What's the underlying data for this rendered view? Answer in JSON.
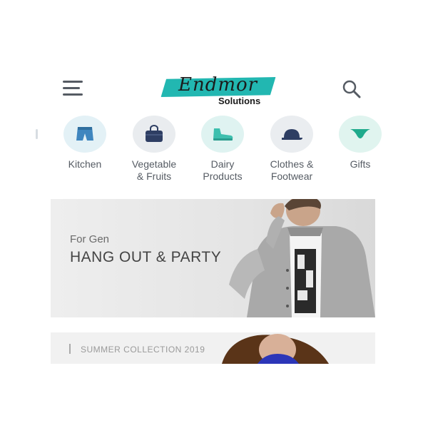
{
  "header": {
    "logo_script": "Endmor",
    "logo_sub": "Solutions",
    "menu_icon": "hamburger-menu-icon",
    "search_icon": "search-icon",
    "brand_color": "#22b7b1"
  },
  "categories": [
    {
      "label": "Kitchen",
      "icon": "shorts-icon",
      "bg": "#e3f1f6"
    },
    {
      "label": "Vegetable\n& Fruits",
      "icon": "handbag-icon",
      "bg": "#e9ecef"
    },
    {
      "label": "Dairy\nProducts",
      "icon": "sneaker-icon",
      "bg": "#dff3f1"
    },
    {
      "label": "Clothes &\nFootwear",
      "icon": "cap-icon",
      "bg": "#eaedf0"
    },
    {
      "label": "Gifts",
      "icon": "swimwear-icon",
      "bg": "#e0f4ef"
    }
  ],
  "banner": {
    "subtitle": "For Gen",
    "title": "HANG OUT & PARTY"
  },
  "banner2": {
    "title": "SUMMER COLLECTION 2019"
  }
}
